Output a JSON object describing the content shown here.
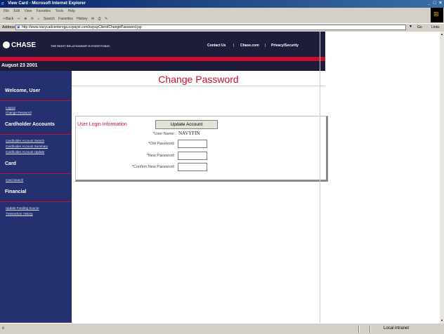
{
  "window": {
    "title": "View Card - Microsoft Internet Explorer",
    "controls": "_ □ ×"
  },
  "menu": [
    "File",
    "Edit",
    "View",
    "Favorites",
    "Tools",
    "Help"
  ],
  "toolbar": {
    "back": "⇦Back",
    "forward": "⇨",
    "stop": "⊗",
    "refresh": "⟳",
    "home": "⌂",
    "search": "Search",
    "favorites": "Favorites",
    "history": "History",
    "mail": "✉",
    "print": "⎙",
    "edit": "✎"
  },
  "address": {
    "label": "Address",
    "url": "http://www.navycadcentervga.ezpayst.com/ezpayClient/ChangePassword.jsp",
    "go": "Go",
    "links": "Links"
  },
  "banner": {
    "logo": "CHASE",
    "tagline": "THE RIGHT RELATIONSHIP IS EVERYTHING.",
    "nav": [
      "Contact Us",
      "Chase.com",
      "Privacy/Security"
    ],
    "nav_sep": "|"
  },
  "date": "August 23 2001",
  "sidebar": {
    "welcome": "Welcome, User",
    "welcome_links": [
      "Logout",
      "Change Password"
    ],
    "sections": [
      {
        "heading": "Cardholder Accounts",
        "links": [
          "Cardholder Account Search",
          "Cardholder Account Summary",
          "Cardholder Account Update"
        ]
      },
      {
        "heading": "Card",
        "links": [
          "Card Search"
        ]
      },
      {
        "heading": "Financial",
        "links": [
          "Update Funding Source",
          "Transaction History"
        ]
      }
    ]
  },
  "page": {
    "title": "Change Password",
    "legend": "User Login Information",
    "update_button": "Update Account",
    "fields": [
      {
        "label": "*User Name:",
        "value": "NAVYFIN"
      },
      {
        "label": "*Old Password:",
        "value": ""
      },
      {
        "label": "*New Password:",
        "value": ""
      },
      {
        "label": "*Confirm New Password:",
        "value": ""
      }
    ]
  },
  "status": {
    "zone": "Local intranet"
  },
  "colors": {
    "chase_navy": "#1d1d3b",
    "sidebar_blue": "#24306f",
    "chase_red": "#c8102e"
  }
}
